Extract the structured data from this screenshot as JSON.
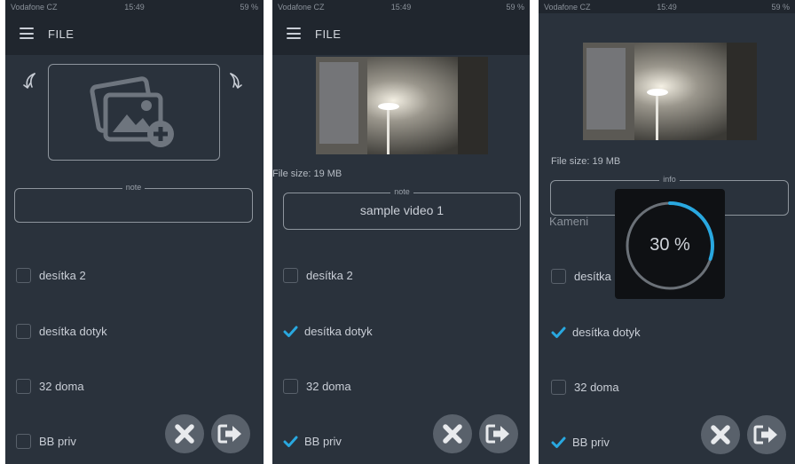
{
  "status_bar": {
    "carrier": "Vodafone CZ",
    "time": "15:49",
    "battery": "59 %"
  },
  "app_title": "FILE",
  "screens": {
    "s1": {
      "note": {
        "legend": "note",
        "value": ""
      },
      "checkboxes": [
        {
          "label": "desítka 2",
          "checked": false
        },
        {
          "label": "desítka dotyk",
          "checked": false
        },
        {
          "label": "32 doma",
          "checked": false
        },
        {
          "label": "BB priv",
          "checked": false
        }
      ]
    },
    "s2": {
      "file_size": "File size: 19 MB",
      "note": {
        "legend": "note",
        "value": "sample video 1"
      },
      "checkboxes": [
        {
          "label": "desítka 2",
          "checked": false
        },
        {
          "label": "desítka dotyk",
          "checked": true
        },
        {
          "label": "32 doma",
          "checked": false
        },
        {
          "label": "BB priv",
          "checked": true
        }
      ]
    },
    "s3": {
      "file_size": "File size: 19 MB",
      "info_legend": "info",
      "partial_text": "Kameni",
      "progress": {
        "label": "30 %",
        "fraction": 0.3
      },
      "checkboxes": [
        {
          "label": "desítka",
          "checked": false
        },
        {
          "label": "desítka dotyk",
          "checked": true
        },
        {
          "label": "32 doma",
          "checked": false
        },
        {
          "label": "BB priv",
          "checked": true
        }
      ]
    }
  },
  "colors": {
    "background": "#2a323c",
    "appbar": "#20262e",
    "accent": "#29a8e0",
    "fab": "#59616b"
  },
  "icons": {
    "menu": "hamburger-icon",
    "rotate_left": "rotate-left-icon",
    "rotate_right": "rotate-right-icon",
    "add_image": "add-image-icon",
    "cancel": "close-icon",
    "submit": "exit-icon",
    "checked": "checkmark-icon"
  }
}
